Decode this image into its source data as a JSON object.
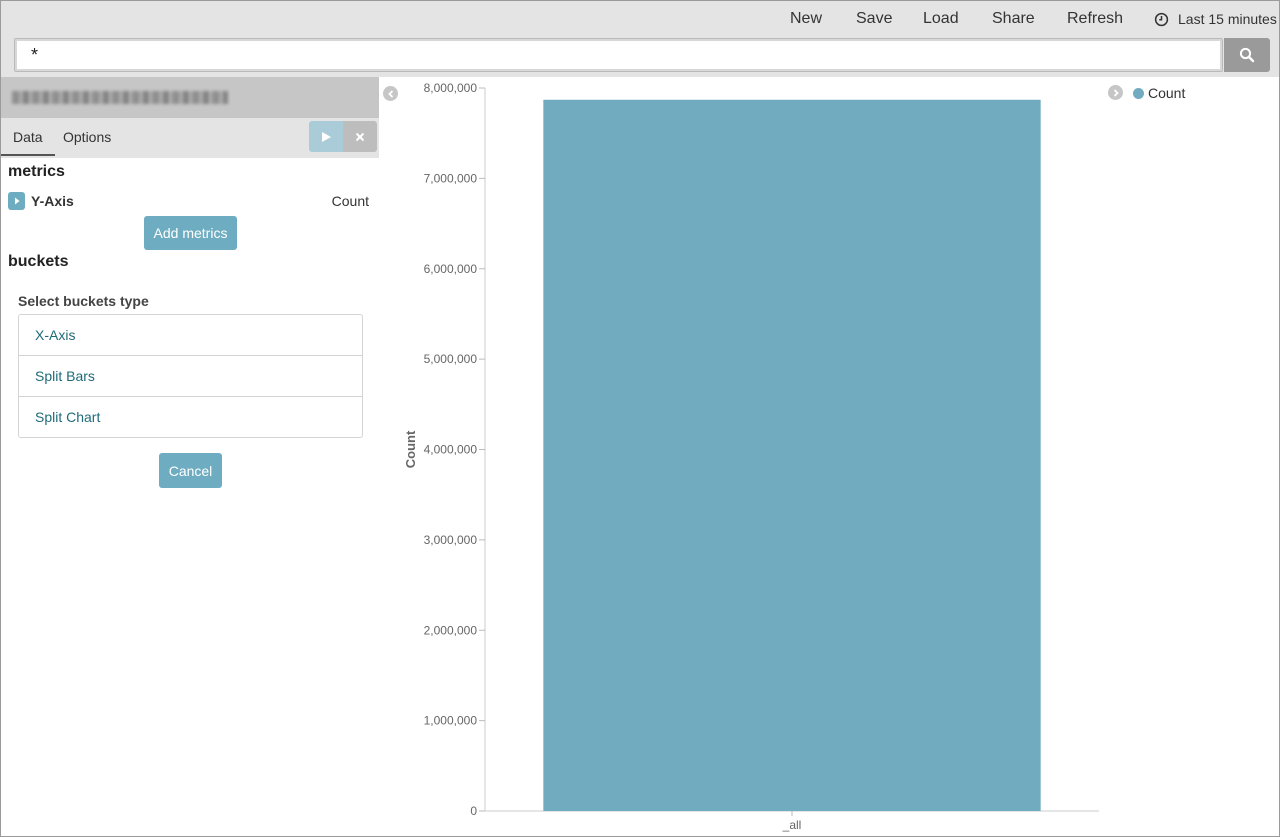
{
  "nav": {
    "items": [
      "New",
      "Save",
      "Load",
      "Share",
      "Refresh"
    ],
    "time_range": "Last 15 minutes"
  },
  "search": {
    "query": "*"
  },
  "sidebar": {
    "tabs": {
      "data": "Data",
      "options": "Options"
    },
    "metrics_heading": "metrics",
    "metric": {
      "label": "Y-Axis",
      "value": "Count"
    },
    "add_metrics_label": "Add metrics",
    "buckets_heading": "buckets",
    "select_buckets_label": "Select buckets type",
    "bucket_types": [
      "X-Axis",
      "Split Bars",
      "Split Chart"
    ],
    "cancel_label": "Cancel"
  },
  "colors": {
    "accent": "#6eadc1",
    "bar": "#71abbf"
  },
  "chart_data": {
    "type": "bar",
    "categories": [
      "_all"
    ],
    "series": [
      {
        "name": "Count",
        "values": [
          7870000
        ]
      }
    ],
    "ylabel": "Count",
    "xlabel": "",
    "ylim": [
      0,
      8000000
    ],
    "yticks": [
      0,
      1000000,
      2000000,
      3000000,
      4000000,
      5000000,
      6000000,
      7000000,
      8000000
    ],
    "ytick_labels": [
      "0",
      "1,000,000",
      "2,000,000",
      "3,000,000",
      "4,000,000",
      "5,000,000",
      "6,000,000",
      "7,000,000",
      "8,000,000"
    ],
    "legend": [
      "Count"
    ],
    "legend_position": "top-right",
    "grid": false
  }
}
